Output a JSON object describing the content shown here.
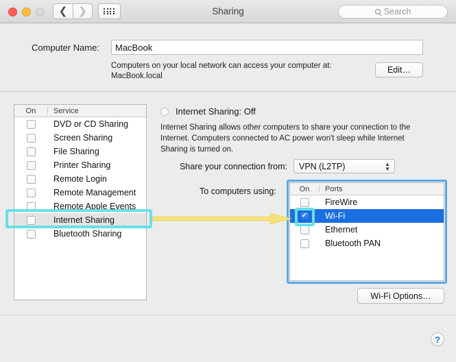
{
  "titlebar": {
    "title": "Sharing",
    "back_icon": "chevron-left-icon",
    "forward_icon": "chevron-right-icon",
    "grid_icon": "grid-view-icon",
    "search_placeholder": "Search"
  },
  "computer_name": {
    "label": "Computer Name:",
    "value": "MacBook",
    "help_text": "Computers on your local network can access your computer at: MacBook.local",
    "edit_button": "Edit…"
  },
  "services": {
    "header_on": "On",
    "header_service": "Service",
    "items": [
      {
        "label": "DVD or CD Sharing",
        "checked": false,
        "state": "normal"
      },
      {
        "label": "Screen Sharing",
        "checked": false,
        "state": "normal"
      },
      {
        "label": "File Sharing",
        "checked": false,
        "state": "normal"
      },
      {
        "label": "Printer Sharing",
        "checked": false,
        "state": "normal"
      },
      {
        "label": "Remote Login",
        "checked": false,
        "state": "normal"
      },
      {
        "label": "Remote Management",
        "checked": false,
        "state": "normal"
      },
      {
        "label": "Remote Apple Events",
        "checked": false,
        "state": "normal"
      },
      {
        "label": "Internet Sharing",
        "checked": false,
        "state": "highlight"
      },
      {
        "label": "Bluetooth Sharing",
        "checked": false,
        "state": "normal"
      }
    ]
  },
  "detail": {
    "status_label": "Internet Sharing: Off",
    "description": "Internet Sharing allows other computers to share your connection to the Internet. Computers connected to AC power won't sleep while Internet Sharing is turned on.",
    "share_from_label": "Share your connection from:",
    "share_from_value": "VPN (L2TP)",
    "to_computers_label": "To computers using:",
    "wifi_options_button": "Wi-Fi Options…"
  },
  "ports": {
    "header_on": "On",
    "header_ports": "Ports",
    "items": [
      {
        "label": "FireWire",
        "checked": false,
        "state": "normal"
      },
      {
        "label": "Wi-Fi",
        "checked": true,
        "state": "selected"
      },
      {
        "label": "Ethernet",
        "checked": false,
        "state": "normal"
      },
      {
        "label": "Bluetooth PAN",
        "checked": false,
        "state": "normal"
      }
    ]
  },
  "help": {
    "glyph": "?"
  },
  "annotations": {
    "cyan": "#68E0E8",
    "yellow": "#F5E27A",
    "blue_box": "#5AA9E6",
    "selection_blue": "#1B6FE0"
  }
}
